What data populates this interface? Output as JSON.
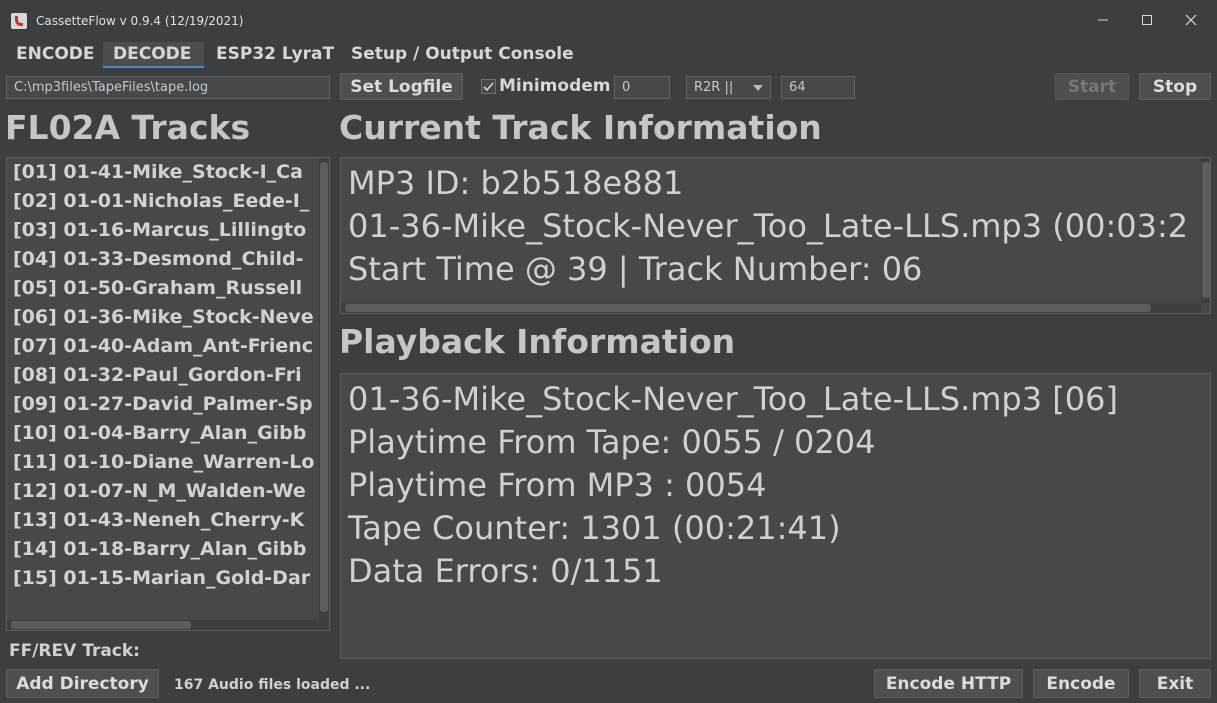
{
  "window": {
    "title": "CassetteFlow v 0.9.4 (12/19/2021)"
  },
  "tabs": [
    {
      "label": "ENCODE",
      "active": false
    },
    {
      "label": "DECODE",
      "active": true
    },
    {
      "label": "ESP32 LyraT",
      "active": false
    },
    {
      "label": "Setup / Output Console",
      "active": false
    }
  ],
  "toolbar": {
    "logfile_path": "C:\\mp3files\\TapeFiles\\tape.log",
    "set_logfile_label": "Set Logfile",
    "minimodem_label": "Minimodem",
    "minimodem_checked": true,
    "minimodem_value": "0",
    "mode_select": "R2R ||",
    "baud_value": "64",
    "start_label": "Start",
    "stop_label": "Stop"
  },
  "tracks": {
    "heading": "FL02A Tracks",
    "items": [
      "[01] 01-41-Mike_Stock-I_Ca",
      "[02] 01-01-Nicholas_Eede-I_",
      "[03] 01-16-Marcus_Lillingto",
      "[04] 01-33-Desmond_Child-",
      "[05] 01-50-Graham_Russell",
      "[06] 01-36-Mike_Stock-Neve",
      "[07] 01-40-Adam_Ant-Frienc",
      "[08] 01-32-Paul_Gordon-Fri",
      "[09] 01-27-David_Palmer-Sp",
      "[10] 01-04-Barry_Alan_Gibb",
      "[11] 01-10-Diane_Warren-Lo",
      "[12] 01-07-N_M_Walden-We",
      "[13] 01-43-Neneh_Cherry-K",
      "[14] 01-18-Barry_Alan_Gibb",
      "[15] 01-15-Marian_Gold-Dar"
    ],
    "ffrev_label": "FF/REV Track:"
  },
  "current_track": {
    "heading": "Current Track Information",
    "lines": [
      "MP3 ID: b2b518e881",
      "01-36-Mike_Stock-Never_Too_Late-LLS.mp3 (00:03:2",
      "Start Time @ 39 | Track Number: 06"
    ]
  },
  "playback": {
    "heading": "Playback Information",
    "lines": [
      "01-36-Mike_Stock-Never_Too_Late-LLS.mp3 [06]",
      "Playtime From Tape: 0055 / 0204",
      "Playtime From MP3 : 0054",
      "Tape Counter: 1301 (00:21:41)",
      "Data Errors: 0/1151"
    ]
  },
  "footer": {
    "add_directory_label": "Add Directory",
    "status": "167 Audio files loaded ...",
    "encode_http_label": "Encode HTTP",
    "encode_label": "Encode",
    "exit_label": "Exit"
  },
  "colors": {
    "background": "#3c3f41",
    "panel": "#45494a",
    "accent": "#4a88c7",
    "text": "#d0d0d0"
  },
  "icons": [
    "java-app-icon",
    "minimize-icon",
    "maximize-icon",
    "close-icon",
    "checkbox-checked-icon",
    "dropdown-arrow-icon"
  ]
}
